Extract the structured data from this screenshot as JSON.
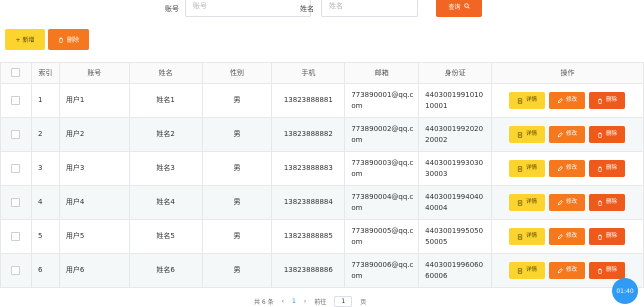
{
  "search": {
    "account_label": "账号",
    "account_placeholder": "账号",
    "name_label": "姓名",
    "name_placeholder": "姓名",
    "query_label": "查询"
  },
  "toolbar": {
    "add_label": "+ 新增",
    "delete_label": "删除"
  },
  "table": {
    "columns": [
      "",
      "索引",
      "账号",
      "姓名",
      "性别",
      "手机",
      "邮箱",
      "身份证",
      "操作"
    ],
    "rows": [
      {
        "index": "1",
        "account": "用户1",
        "name": "姓名1",
        "gender": "男",
        "phone": "13823888881",
        "email": "773890001@qq.com",
        "id_card": "440300199101010001"
      },
      {
        "index": "2",
        "account": "用户2",
        "name": "姓名2",
        "gender": "男",
        "phone": "13823888882",
        "email": "773890002@qq.com",
        "id_card": "440300199202020002"
      },
      {
        "index": "3",
        "account": "用户3",
        "name": "姓名3",
        "gender": "男",
        "phone": "13823888883",
        "email": "773890003@qq.com",
        "id_card": "440300199303030003"
      },
      {
        "index": "4",
        "account": "用户4",
        "name": "姓名4",
        "gender": "男",
        "phone": "13823888884",
        "email": "773890004@qq.com",
        "id_card": "440300199404040004"
      },
      {
        "index": "5",
        "account": "用户5",
        "name": "姓名5",
        "gender": "男",
        "phone": "13823888885",
        "email": "773890005@qq.com",
        "id_card": "440300199505050005"
      },
      {
        "index": "6",
        "account": "用户6",
        "name": "姓名6",
        "gender": "男",
        "phone": "13823888886",
        "email": "773890006@qq.com",
        "id_card": "440300199606060006"
      }
    ],
    "actions": {
      "detail_label": "详情",
      "edit_label": "修改",
      "delete_label": "删除"
    }
  },
  "pagination": {
    "total_text": "共 6 条",
    "prev_icon": "‹",
    "current_page": "1",
    "next_icon": "›",
    "goto_label": "前往",
    "goto_value": "1",
    "page_unit": "页"
  },
  "floating_badge": "01:40",
  "colors": {
    "primary_yellow": "#fbd42f",
    "primary_orange": "#f5781e",
    "danger_red": "#ee5a1c",
    "fab_blue": "#2f9bf5"
  },
  "icons": {
    "query": "search-icon",
    "delete": "trash-icon",
    "detail": "doc-icon",
    "edit": "pencil-icon"
  }
}
